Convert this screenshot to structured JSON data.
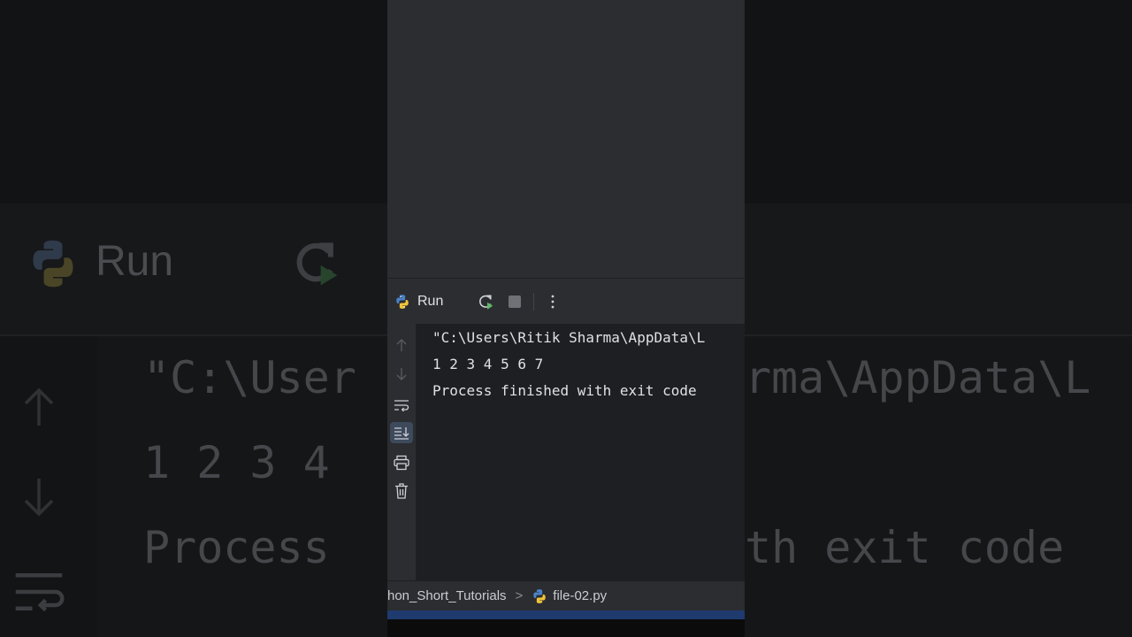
{
  "background": {
    "run_label": "Run",
    "lines": [
      "\"C:\\User",
      "rma\\AppData\\L",
      "1 2 3 4",
      "Process",
      "th exit code"
    ]
  },
  "run_panel": {
    "tab_label": "Run",
    "tab_icon": "python-icon",
    "rerun_icon": "rerun-icon",
    "stop_icon": "stop-icon",
    "more_icon": "more-options-icon"
  },
  "gutter_icons": [
    "arrow-up-icon",
    "arrow-down-icon",
    "soft-wrap-icon",
    "scroll-to-end-icon",
    "print-icon",
    "trash-icon"
  ],
  "console": {
    "lines": [
      "\"C:\\Users\\Ritik Sharma\\AppData\\L",
      "1 2 3 4 5 6 7",
      "Process finished with exit code"
    ]
  },
  "status_bar": {
    "project": "hon_Short_Tutorials",
    "separator": ">",
    "file": "file-02.py"
  },
  "colors": {
    "panel": "#2b2d30",
    "console_bg": "#1e1f22",
    "text": "#dfe1e5",
    "accent": "#1f3a6e"
  }
}
